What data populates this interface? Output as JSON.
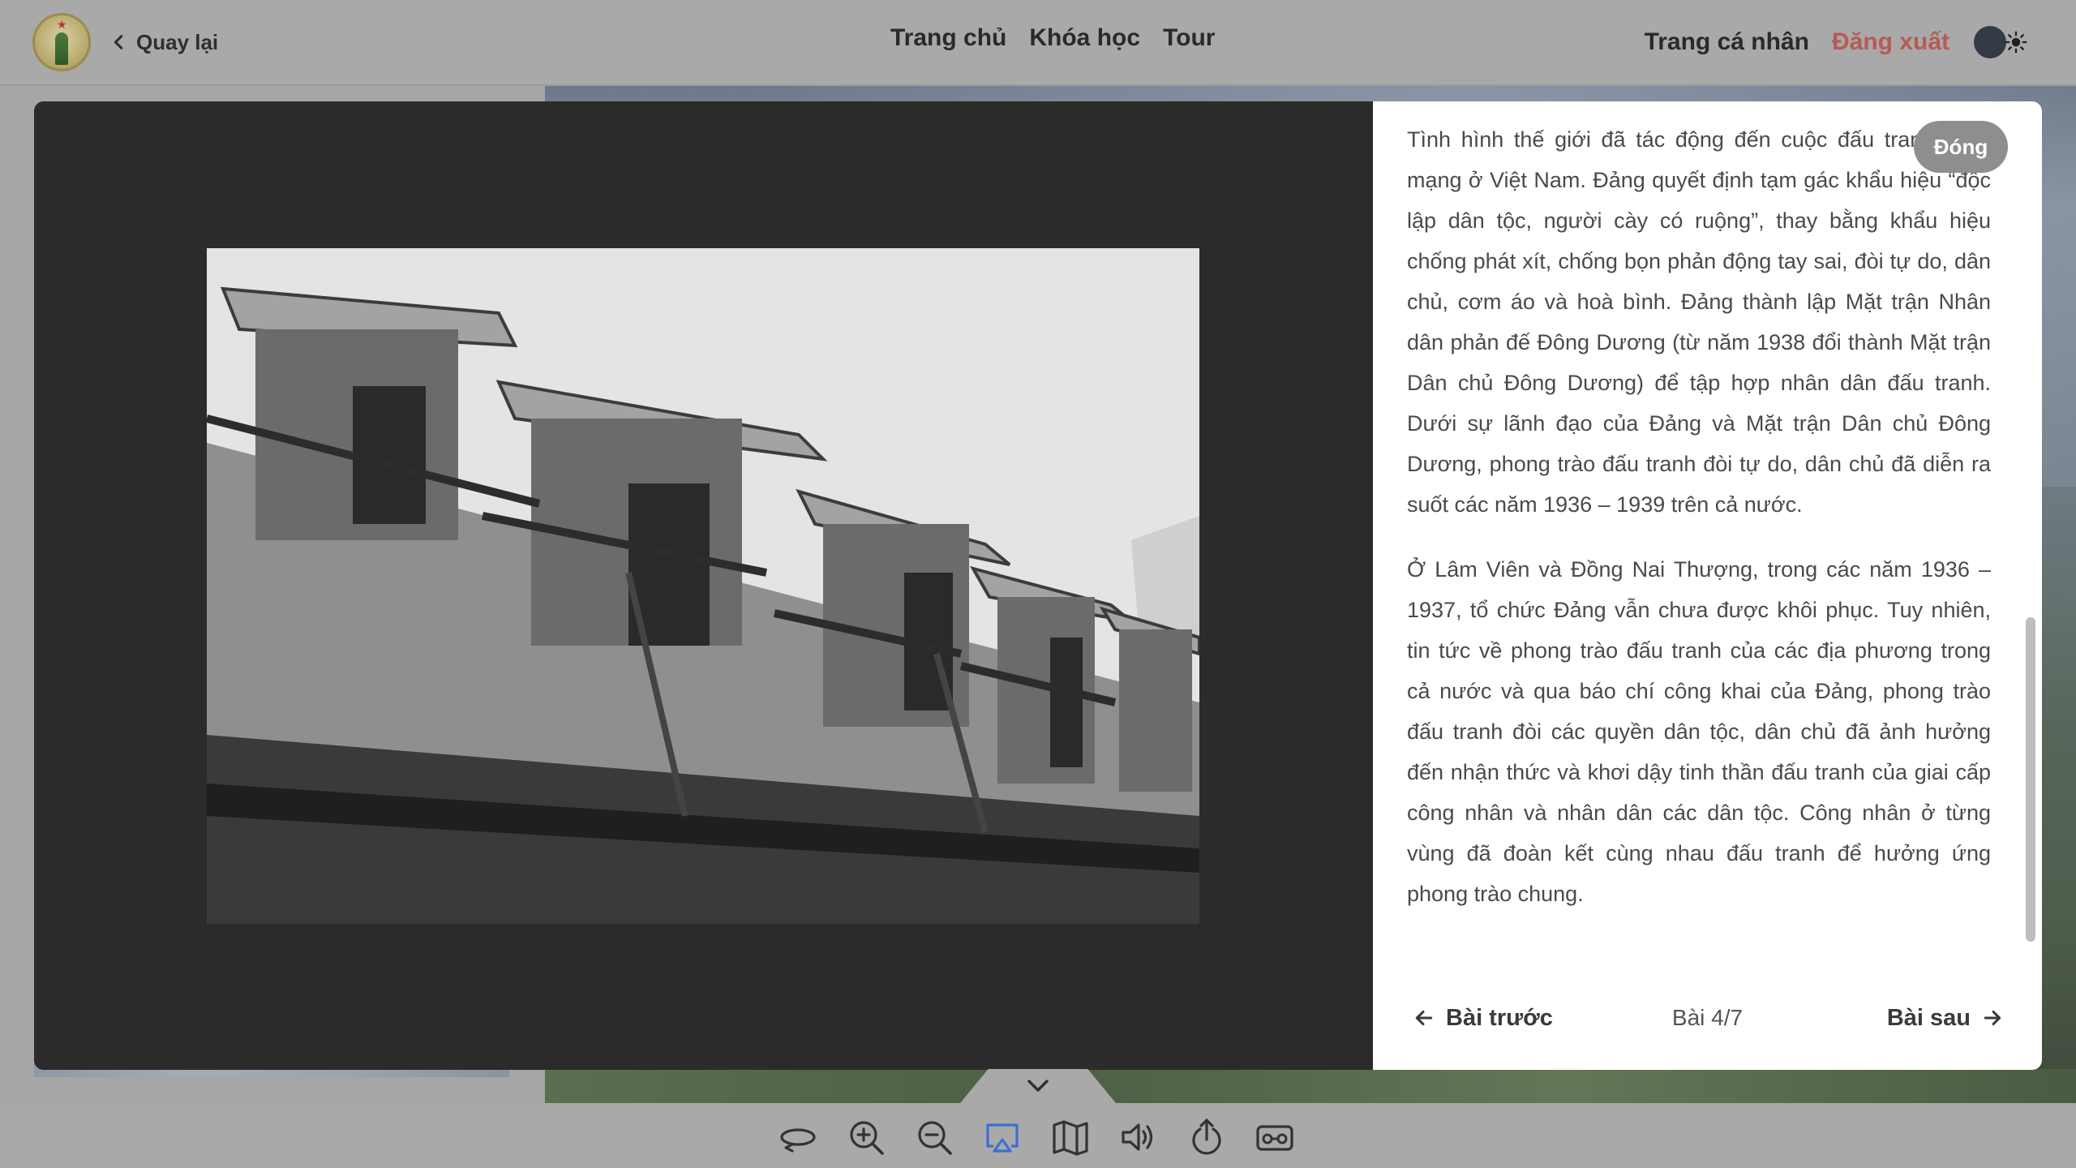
{
  "header": {
    "back_label": "Quay lại",
    "nav": [
      "Trang chủ",
      "Khóa học",
      "Tour"
    ],
    "profile_label": "Trang cá nhân",
    "logout_label": "Đăng xuất"
  },
  "modal": {
    "close_label": "Đóng",
    "paragraphs": [
      "Tình hình thế giới đã tác động đến cuộc đấu tranh cách mạng ở Việt Nam. Đảng quyết định tạm gác khẩu hiệu “độc lập dân tộc, người cày có ruộng”, thay bằng khẩu hiệu chống phát xít, chống bọn phản động tay sai, đòi tự do, dân chủ, cơm áo và hoà bình. Đảng thành lập Mặt trận Nhân dân phản đế Đông Dương (từ năm 1938 đổi thành Mặt trận Dân chủ Đông Dương) để tập hợp nhân dân đấu tranh. Dưới sự lãnh đạo của Đảng và Mặt trận Dân chủ Đông Dương, phong trào đấu tranh đòi tự do, dân chủ đã diễn ra suốt các năm 1936 – 1939 trên cả nước.",
      "Ở Lâm Viên và Đồng Nai Thượng, trong các năm 1936 – 1937, tổ chức Đảng vẫn chưa được khôi phục. Tuy nhiên, tin tức về phong trào đấu tranh của các địa phương trong cả nước và qua báo chí công khai của Đảng, phong trào đấu tranh đòi các quyền dân tộc, dân chủ đã ảnh hưởng đến nhận thức và khơi dậy tinh thần đấu tranh của giai cấp công nhân và nhân dân các dân tộc. Công nhân ở từng vùng đã đoàn kết cùng nhau đấu tranh để hưởng ứng phong trào chung."
    ],
    "prev_label": "Bài trước",
    "next_label": "Bài sau",
    "lesson_counter": "Bài 4/7"
  },
  "toolbar": {
    "tools": [
      "rotate-icon",
      "zoom-in-icon",
      "zoom-out-icon",
      "cast-icon",
      "map-icon",
      "volume-icon",
      "share-icon",
      "vr-headset-icon"
    ],
    "active_tool": "cast-icon",
    "active_color": "#3b6fd1"
  },
  "colors": {
    "logout": "#b85a55",
    "text": "#4a4a4a",
    "modal_dark": "#2b2b2b"
  }
}
